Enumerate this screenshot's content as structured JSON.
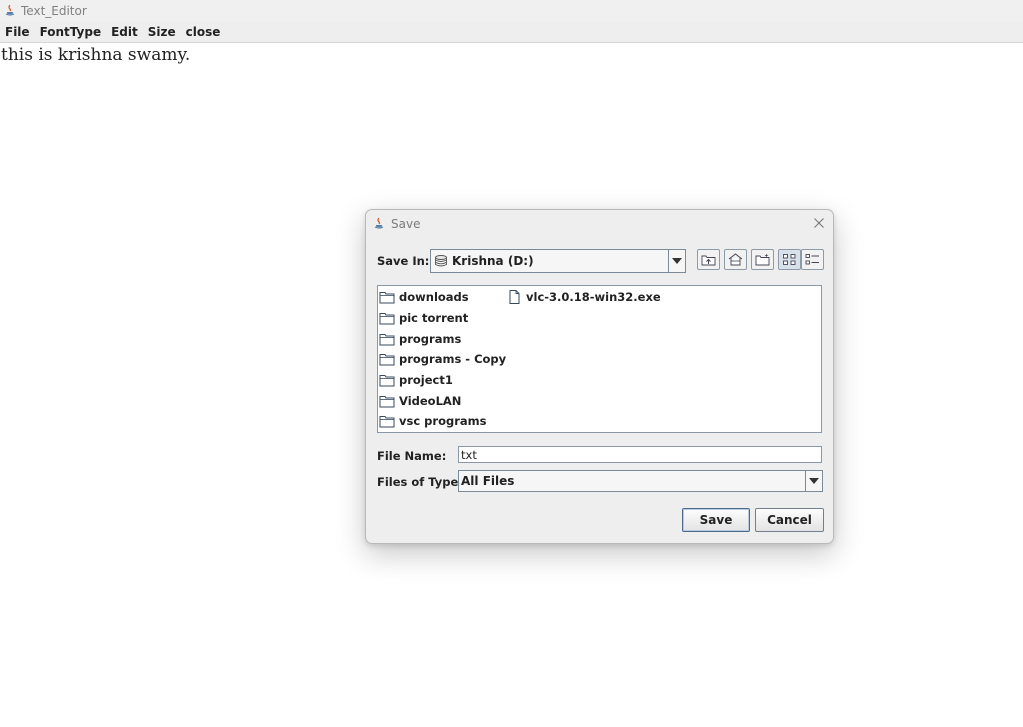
{
  "window": {
    "title": "Text_Editor"
  },
  "menubar": {
    "items": [
      "File",
      "FontType",
      "Edit",
      "Size",
      "close"
    ]
  },
  "editor": {
    "content": "this is krishna swamy."
  },
  "dialog": {
    "title": "Save",
    "save_in_label": "Save In:",
    "save_in_value": "Krishna (D:)",
    "toolbar_icons": [
      "up-folder-icon",
      "home-icon",
      "new-folder-icon",
      "list-view-icon",
      "details-view-icon"
    ],
    "files": [
      {
        "name": "downloads",
        "type": "folder"
      },
      {
        "name": "pic torrent",
        "type": "folder"
      },
      {
        "name": "programs",
        "type": "folder"
      },
      {
        "name": "programs - Copy",
        "type": "folder"
      },
      {
        "name": "project1",
        "type": "folder"
      },
      {
        "name": "VideoLAN",
        "type": "folder"
      },
      {
        "name": "vsc programs",
        "type": "folder"
      },
      {
        "name": "vlc-3.0.18-win32.exe",
        "type": "file"
      }
    ],
    "file_name_label": "File Name:",
    "file_name_value": "txt",
    "files_of_type_label": "Files of Type:",
    "files_of_type_value": "All Files",
    "save_button": "Save",
    "cancel_button": "Cancel"
  }
}
